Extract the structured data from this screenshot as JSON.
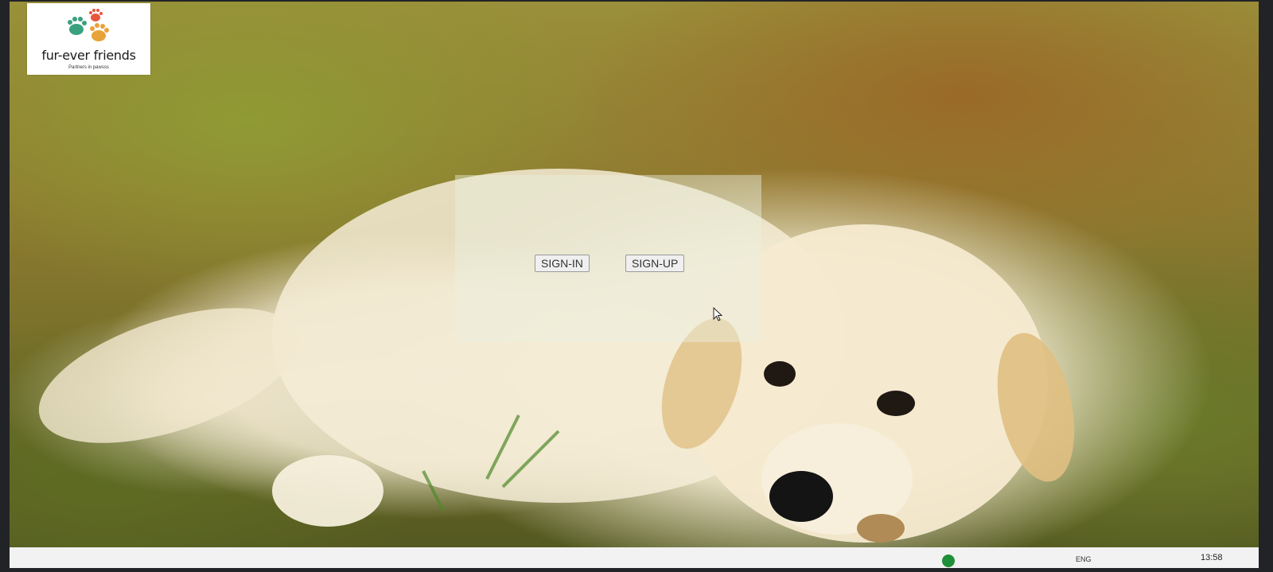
{
  "logo": {
    "name": "fur-ever friends",
    "tagline": "Partners in pawsss",
    "paw_colors": [
      "#3aa17e",
      "#e8553e",
      "#e8a23a",
      "#2f8fc7"
    ]
  },
  "auth": {
    "signin_label": "SIGN-IN",
    "signup_label": "SIGN-UP"
  },
  "taskbar": {
    "language": "ENG",
    "time": "13:58"
  },
  "colors": {
    "panel_overlay": "rgba(235,240,225,0.45)",
    "button_bg": "#efefef",
    "button_border": "#9a9a9a"
  }
}
